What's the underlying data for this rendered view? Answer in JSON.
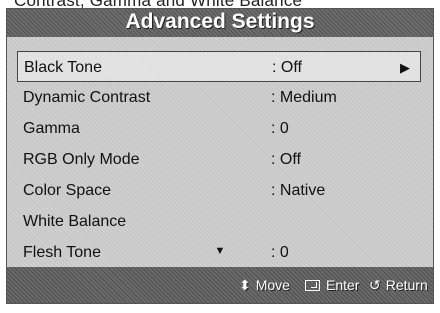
{
  "clipped_header": "Contrast, Gamma and White Balance",
  "title": "Advanced Settings",
  "items": [
    {
      "label": "Black Tone",
      "value": ": Off",
      "has_submenu": true
    },
    {
      "label": "Dynamic Contrast",
      "value": ": Medium"
    },
    {
      "label": "Gamma",
      "value": ": 0"
    },
    {
      "label": "RGB Only Mode",
      "value": ": Off"
    },
    {
      "label": "Color Space",
      "value": ": Native"
    },
    {
      "label": "White Balance",
      "value": ""
    },
    {
      "label": "Flesh Tone",
      "value": ": 0"
    }
  ],
  "scroll_down_glyph": "▼",
  "submenu_glyph": "▶",
  "footer": {
    "move_icon": "⬍",
    "move_label": "Move",
    "enter_label": "Enter",
    "return_icon": "↺",
    "return_label": "Return"
  },
  "colors": {
    "panel": "#cfcfcf",
    "bar": "#6d6d6d",
    "selection_border": "#444444"
  }
}
